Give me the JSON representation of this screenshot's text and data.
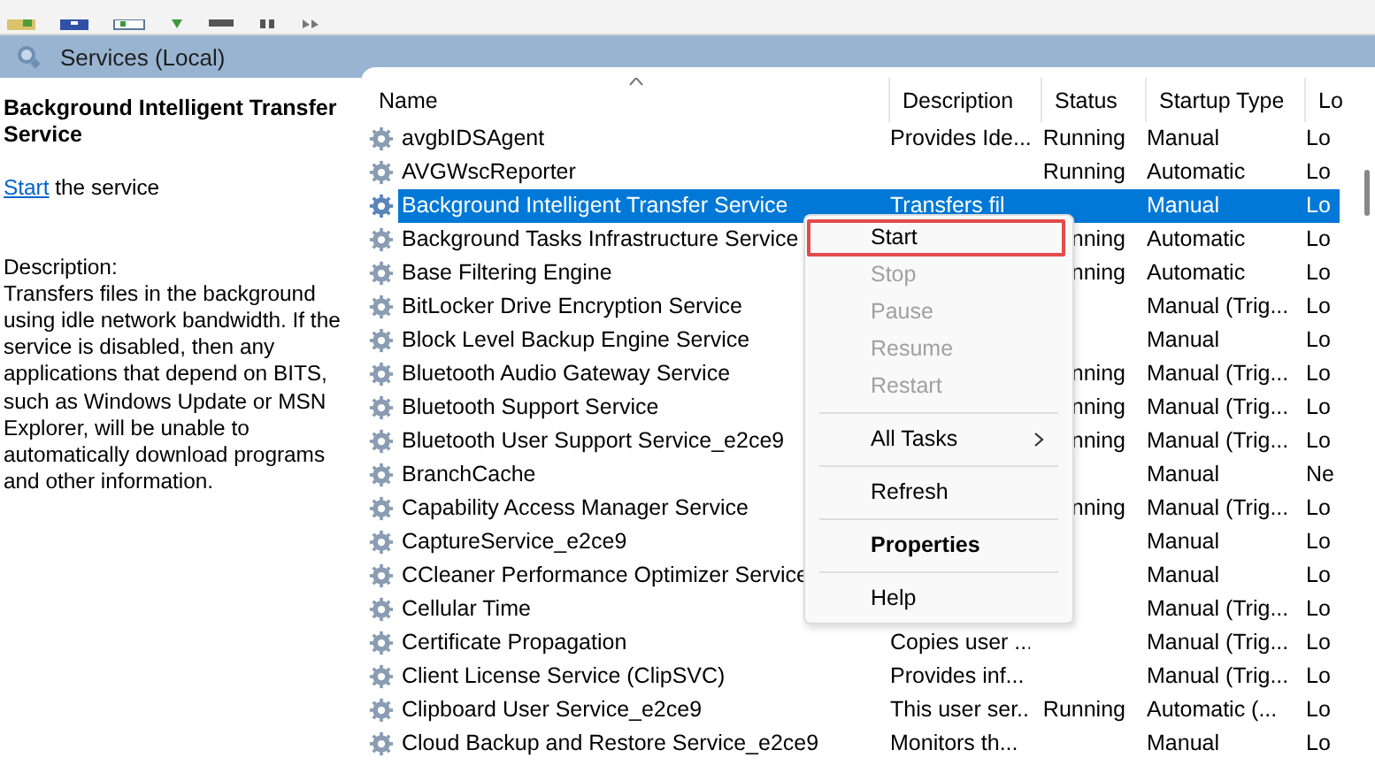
{
  "header": {
    "title": "Services (Local)"
  },
  "detail": {
    "title": "Background Intelligent Transfer Service",
    "action_link": "Start",
    "action_text": "the service",
    "description_label": "Description:",
    "description": "Transfers files in the background using idle network bandwidth. If the service is disabled, then any applications that depend on BITS, such as Windows Update or MSN Explorer, will be unable to automatically download programs and other information."
  },
  "table": {
    "columns": [
      "Name",
      "Description",
      "Status",
      "Startup Type",
      "Lo"
    ],
    "rows": [
      {
        "name": "avgbIDSAgent",
        "description": "Provides Ide...",
        "status": "Running",
        "startup_type": "Manual",
        "column_5": "Lo",
        "selected": false
      },
      {
        "name": "AVGWscReporter",
        "status": "Running",
        "startup_type": "Automatic",
        "column_5": "Lo",
        "selected": false
      },
      {
        "name": "Background Intelligent Transfer Service",
        "description": "Transfers fil",
        "startup_type": "Manual",
        "column_5": "Lo",
        "selected": true
      },
      {
        "name": "Background Tasks Infrastructure Service",
        "status": "nning",
        "startup_type": "Automatic",
        "column_5": "Lo",
        "selected": false
      },
      {
        "name": "Base Filtering Engine",
        "status": "nning",
        "startup_type": "Automatic",
        "column_5": "Lo",
        "selected": false
      },
      {
        "name": "BitLocker Drive Encryption Service",
        "startup_type": "Manual (Trig...",
        "column_5": "Lo",
        "selected": false
      },
      {
        "name": "Block Level Backup Engine Service",
        "startup_type": "Manual",
        "column_5": "Lo",
        "selected": false
      },
      {
        "name": "Bluetooth Audio Gateway Service",
        "status": "nning",
        "startup_type": "Manual (Trig...",
        "column_5": "Lo",
        "selected": false
      },
      {
        "name": "Bluetooth Support Service",
        "status": "nning",
        "startup_type": "Manual (Trig...",
        "column_5": "Lo",
        "selected": false
      },
      {
        "name": "Bluetooth User Support Service_e2ce9",
        "status": "nning",
        "startup_type": "Manual (Trig...",
        "column_5": "Lo",
        "selected": false
      },
      {
        "name": "BranchCache",
        "startup_type": "Manual",
        "column_5": "Ne",
        "selected": false
      },
      {
        "name": "Capability Access Manager Service",
        "status": "nning",
        "startup_type": "Manual (Trig...",
        "column_5": "Lo",
        "selected": false
      },
      {
        "name": "CaptureService_e2ce9",
        "startup_type": "Manual",
        "column_5": "Lo",
        "selected": false
      },
      {
        "name": "CCleaner Performance Optimizer Service",
        "startup_type": "Manual",
        "column_5": "Lo",
        "selected": false
      },
      {
        "name": "Cellular Time",
        "startup_type": "Manual (Trig...",
        "column_5": "Lo",
        "selected": false
      },
      {
        "name": "Certificate Propagation",
        "description": "Copies user ...",
        "startup_type": "Manual (Trig...",
        "column_5": "Lo",
        "selected": false
      },
      {
        "name": "Client License Service (ClipSVC)",
        "description": "Provides inf...",
        "startup_type": "Manual (Trig...",
        "column_5": "Lo",
        "selected": false
      },
      {
        "name": "Clipboard User Service_e2ce9",
        "description": "This user ser...",
        "status": "Running",
        "startup_type": "Automatic (...",
        "column_5": "Lo",
        "selected": false
      },
      {
        "name": "Cloud Backup and Restore Service_e2ce9",
        "description": "Monitors th...",
        "startup_type": "Manual",
        "column_5": "Lo",
        "selected": false
      }
    ]
  },
  "context_menu": {
    "items": [
      {
        "kind": "item",
        "label": "Start",
        "disabled": false,
        "highlighted": true,
        "default": false
      },
      {
        "kind": "item",
        "label": "Stop",
        "disabled": true,
        "highlighted": false,
        "default": false
      },
      {
        "kind": "item",
        "label": "Pause",
        "disabled": true,
        "highlighted": false,
        "default": false
      },
      {
        "kind": "item",
        "label": "Resume",
        "disabled": true,
        "highlighted": false,
        "default": false
      },
      {
        "kind": "item",
        "label": "Restart",
        "disabled": true,
        "highlighted": false,
        "default": false
      },
      {
        "kind": "separator"
      },
      {
        "kind": "submenu",
        "label": "All Tasks",
        "disabled": false,
        "highlighted": false,
        "default": false
      },
      {
        "kind": "separator"
      },
      {
        "kind": "item",
        "label": "Refresh",
        "disabled": false,
        "highlighted": false,
        "default": false
      },
      {
        "kind": "separator"
      },
      {
        "kind": "item",
        "label": "Properties",
        "disabled": false,
        "highlighted": false,
        "default": true
      },
      {
        "kind": "separator"
      },
      {
        "kind": "item",
        "label": "Help",
        "disabled": false,
        "highlighted": false,
        "default": false
      }
    ]
  }
}
